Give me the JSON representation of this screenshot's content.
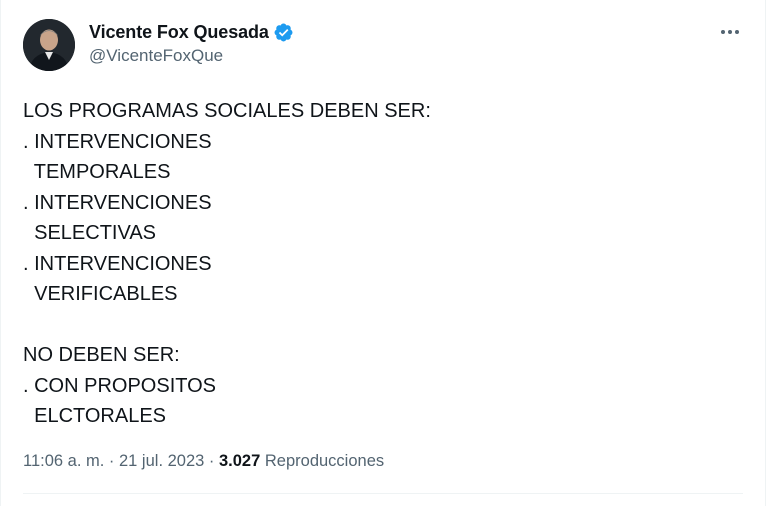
{
  "author": {
    "display_name": "Vicente Fox Quesada",
    "handle": "@VicenteFoxQue",
    "verified": true,
    "avatar_icon": "profile-photo"
  },
  "more_icon": "more-options-icon",
  "tweet_lines": [
    "LOS PROGRAMAS SOCIALES DEBEN SER:",
    ". INTERVENCIONES",
    "  TEMPORALES",
    ". INTERVENCIONES",
    "  SELECTIVAS",
    ". INTERVENCIONES",
    "  VERIFICABLES",
    "",
    "NO DEBEN SER:",
    ". CON PROPOSITOS",
    "  ELCTORALES"
  ],
  "meta": {
    "time": "11:06 a. m.",
    "separator": " · ",
    "date": "21 jul. 2023",
    "views_count": "3.027",
    "views_label": "Reproducciones"
  },
  "colors": {
    "text": "#0f1419",
    "secondary": "#536471",
    "verified_badge": "#1d9bf0",
    "border": "#eff3f4"
  }
}
